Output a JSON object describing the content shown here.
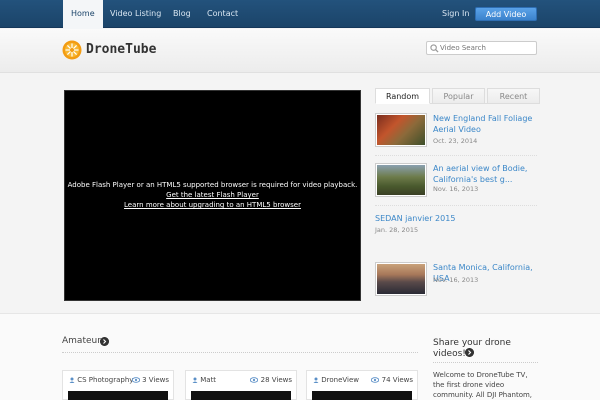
{
  "nav": {
    "items": [
      {
        "label": "Home",
        "active": true
      },
      {
        "label": "Video Listing"
      },
      {
        "label": "Blog"
      },
      {
        "label": "Contact"
      }
    ],
    "signin": "Sign In",
    "add_video": "Add Video"
  },
  "header": {
    "logo_text": "DroneTube",
    "search_placeholder": "Video Search"
  },
  "player": {
    "message": "Adobe Flash Player or an HTML5 supported browser is required for video playback.",
    "link1": "Get the latest Flash Player",
    "link2": "Learn more about upgrading to an HTML5 browser"
  },
  "tabs": [
    "Random",
    "Popular",
    "Recent"
  ],
  "videos": [
    {
      "title": "New England Fall Foliage Aerial Video",
      "date": "Oct. 23, 2014"
    },
    {
      "title": "An aerial view of Bodie, California's best g...",
      "date": "Nov. 16, 2013"
    },
    {
      "title": "SEDAN janvier 2015",
      "date": "Jan. 28, 2015"
    },
    {
      "title": "Santa Monica, California, USA",
      "date": "Nov. 16, 2013"
    }
  ],
  "section": {
    "title": "Amateur",
    "cards": [
      {
        "user": "CS Photography",
        "views": "3 Views"
      },
      {
        "user": "Matt",
        "views": "28 Views"
      },
      {
        "user": "DroneView",
        "views": "74 Views"
      }
    ]
  },
  "sidebar": {
    "title": "Share your drone videos!",
    "text": "Welcome to DroneTube TV, the first drone video community. All DJI Phantom, AR.Drone owners"
  },
  "colors": {
    "nav_bg": "#1b4469",
    "accent": "#3b87c8",
    "button": "#3b82cc"
  }
}
